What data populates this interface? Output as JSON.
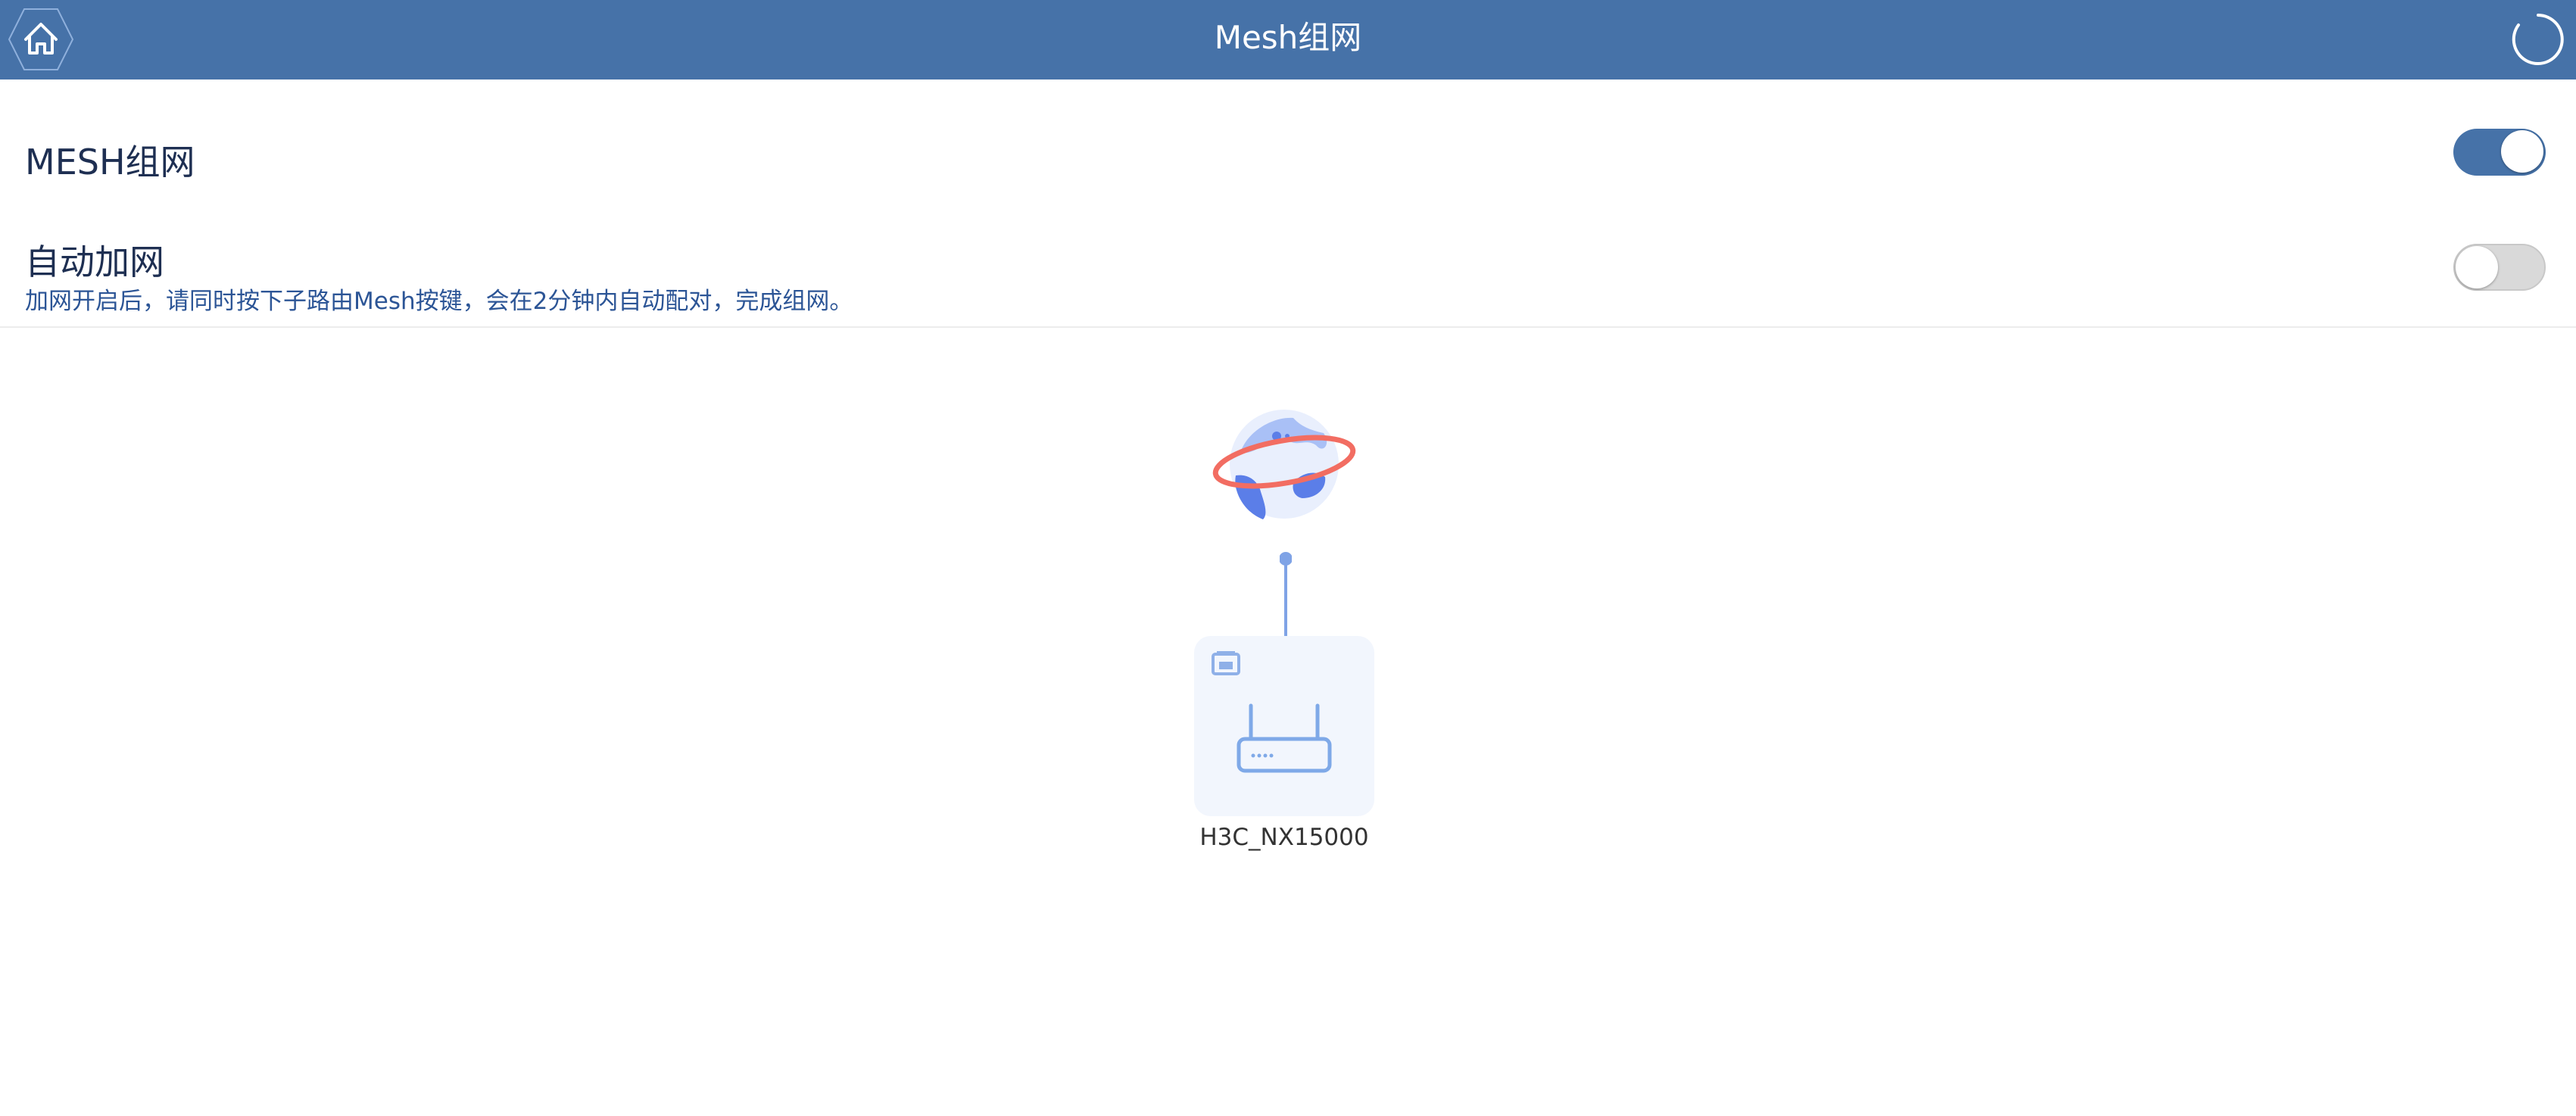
{
  "header": {
    "title": "Mesh组网",
    "home_icon": "home-icon",
    "refresh_icon": "refresh-icon",
    "background_color": "#4672a8"
  },
  "settings": {
    "mesh": {
      "label": "MESH组网",
      "enabled": true
    },
    "auto_join": {
      "label": "自动加网",
      "description": "加网开启后，请同时按下子路由Mesh按键，会在2分钟内自动配对，完成组网。",
      "enabled": false
    }
  },
  "topology": {
    "internet_icon": "internet-globe-icon",
    "device": {
      "name": "H3C_NX15000",
      "port_icon": "lan-port-icon",
      "device_icon": "router-icon"
    }
  },
  "colors": {
    "accent": "#4672a8",
    "toggle_off": "#d9d9d9",
    "device_card": "#f2f6fd",
    "globe_ring": "#f26d62",
    "globe_blue": "#5b7ee8"
  }
}
